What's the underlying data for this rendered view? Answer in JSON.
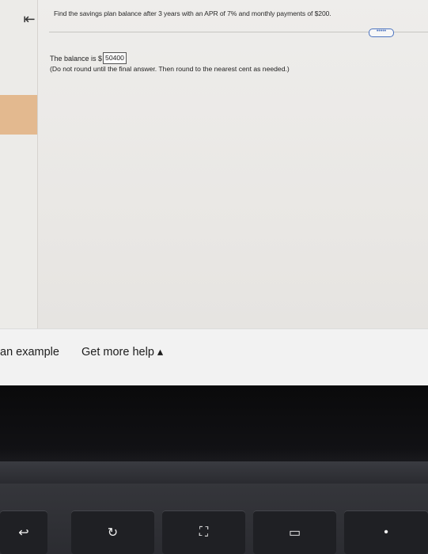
{
  "nav": {
    "back_icon": "⇤"
  },
  "question": {
    "text": "Find the savings plan balance after 3 years with an APR of 7% and monthly payments of $200."
  },
  "more_button": {
    "label": "•••••"
  },
  "answer": {
    "prefix": "The balance is $",
    "value": "50400",
    "note": "(Do not round until the final answer. Then round to the nearest cent as needed.)"
  },
  "help_links": {
    "example": "an example",
    "more_help": "Get more help ▴"
  },
  "keyboard": {
    "keys": [
      {
        "name": "back-arrow-key",
        "glyph": "↩"
      },
      {
        "name": "refresh-key",
        "glyph": "↻"
      },
      {
        "name": "fullscreen-key",
        "glyph": "⛶"
      },
      {
        "name": "overview-key",
        "glyph": "▭"
      },
      {
        "name": "brightness-key",
        "glyph": "•"
      }
    ]
  },
  "colors": {
    "accent_rail": "#e3b98f",
    "link_button": "#4d74c0"
  }
}
